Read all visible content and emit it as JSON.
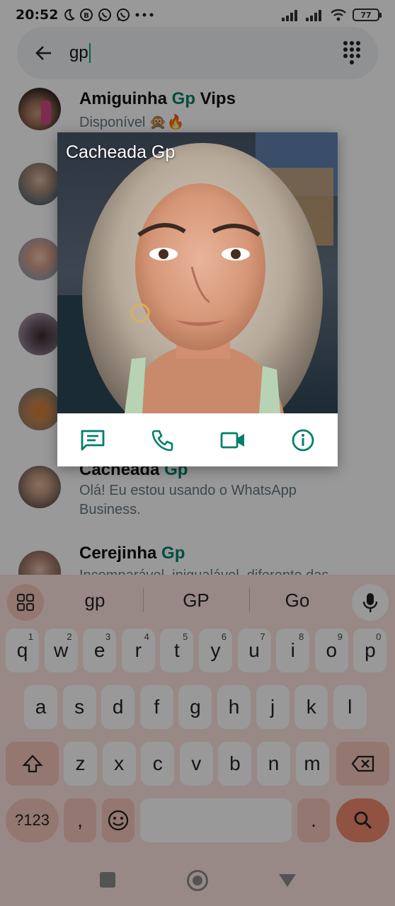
{
  "status_bar": {
    "time": "20:52",
    "battery": "77",
    "icons": [
      "moon-icon",
      "b-badge-icon",
      "whatsapp-icon",
      "whatsapp-icon",
      "more-dots-icon",
      "signal-icon",
      "signal-icon",
      "wifi-icon",
      "battery-icon"
    ]
  },
  "search": {
    "query": "gp",
    "back_icon": "arrow-back-icon",
    "dialpad_icon": "dialpad-icon"
  },
  "contacts": [
    {
      "name_prefix": "Amiguinha ",
      "name_match": "Gp",
      "name_suffix": " Vips",
      "status": "Disponível 🙊🔥"
    },
    {
      "name_prefix": "",
      "name_match": "",
      "name_suffix": "",
      "status": ""
    },
    {
      "name_prefix": "",
      "name_match": "",
      "name_suffix": "",
      "status": ""
    },
    {
      "name_prefix": "",
      "name_match": "",
      "name_suffix": "",
      "status": ""
    },
    {
      "name_prefix": "",
      "name_match": "",
      "name_suffix": "",
      "status": ""
    },
    {
      "name_prefix": "Cacheada ",
      "name_match": "Gp",
      "name_suffix": "",
      "status": "Olá! Eu estou usando o WhatsApp",
      "status_line2": "Business."
    },
    {
      "name_prefix": "Cerejinha ",
      "name_match": "Gp",
      "name_suffix": "",
      "status": "Incomparável, inigualável, diferente das"
    }
  ],
  "popup": {
    "title": "Cacheada Gp",
    "actions": [
      "message-icon",
      "phone-icon",
      "video-call-icon",
      "info-icon"
    ]
  },
  "keyboard": {
    "suggestions": [
      "gp",
      "GP",
      "Go"
    ],
    "row1": [
      {
        "key": "q",
        "hint": "1"
      },
      {
        "key": "w",
        "hint": "2"
      },
      {
        "key": "e",
        "hint": "3"
      },
      {
        "key": "r",
        "hint": "4"
      },
      {
        "key": "t",
        "hint": "5"
      },
      {
        "key": "y",
        "hint": "6"
      },
      {
        "key": "u",
        "hint": "7"
      },
      {
        "key": "i",
        "hint": "8"
      },
      {
        "key": "o",
        "hint": "9"
      },
      {
        "key": "p",
        "hint": "0"
      }
    ],
    "row2": [
      "a",
      "s",
      "d",
      "f",
      "g",
      "h",
      "j",
      "k",
      "l"
    ],
    "row3": [
      "z",
      "x",
      "c",
      "v",
      "b",
      "n",
      "m"
    ],
    "symbols_label": "?123",
    "comma": ",",
    "period": "."
  },
  "colors": {
    "accent": "#008069",
    "keyboard_bg": "#fde5df",
    "keyboard_mod": "#f7c7bc",
    "search_key": "#f08a6f"
  }
}
